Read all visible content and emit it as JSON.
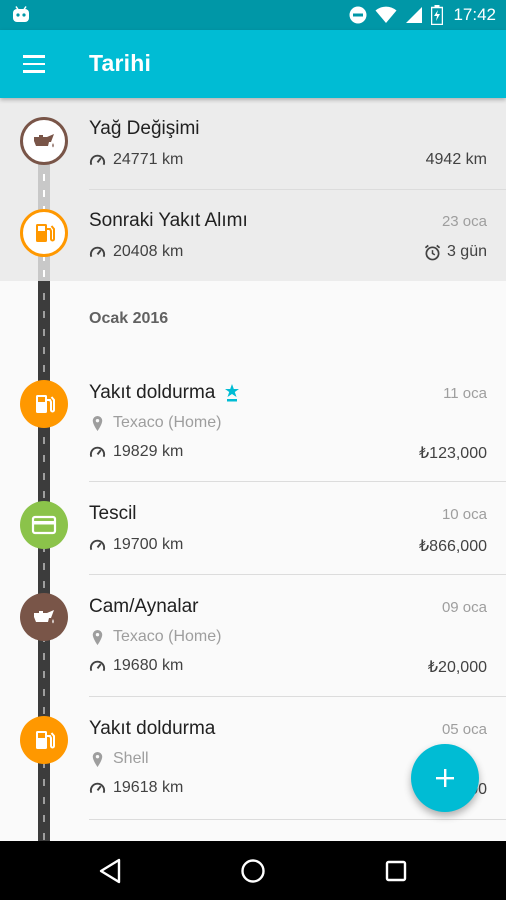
{
  "status_bar": {
    "time": "17:42",
    "icons": [
      "android-icon",
      "do-not-disturb-icon",
      "wifi-icon",
      "signal-icon",
      "battery-charging-icon"
    ]
  },
  "app_bar": {
    "title": "Tarihi",
    "menu_icon": "menu-icon"
  },
  "upcoming": [
    {
      "icon": "oil-can-icon",
      "color": "#795548",
      "title": "Yağ Değişimi",
      "odometer": "24771 km",
      "right_value": "4942 km",
      "date": ""
    },
    {
      "icon": "fuel-pump-icon",
      "color": "#ff9800",
      "title": "Sonraki Yakıt Alımı",
      "odometer": "20408 km",
      "right_value": "3 gün",
      "right_icon": "alarm-icon",
      "date": "23 oca"
    }
  ],
  "section_header": "Ocak 2016",
  "entries": [
    {
      "icon": "fuel-pump-icon",
      "color": "#ff9800",
      "title": "Yakıt doldurma",
      "badge_icon": "full-tank-icon",
      "date": "11 oca",
      "location": "Texaco (Home)",
      "odometer": "19829 km",
      "amount": "₺123,000"
    },
    {
      "icon": "credit-card-icon",
      "color": "#8bc34a",
      "title": "Tescil",
      "date": "10 oca",
      "location": "",
      "odometer": "19700 km",
      "amount": "₺866,000"
    },
    {
      "icon": "oil-can-icon",
      "color": "#795548",
      "title": "Cam/Aynalar",
      "date": "09 oca",
      "location": "Texaco (Home)",
      "odometer": "19680 km",
      "amount": "₺20,000"
    },
    {
      "icon": "fuel-pump-icon",
      "color": "#ff9800",
      "title": "Yakıt doldurma",
      "date": "05 oca",
      "location": "Shell",
      "odometer": "19618 km",
      "amount": "₺…00"
    }
  ],
  "fab": {
    "icon": "plus-icon"
  },
  "nav_bar": {
    "icons": [
      "back-icon",
      "home-icon",
      "recents-icon"
    ]
  },
  "colors": {
    "primary": "#00bcd4",
    "primary_dark": "#0097a7",
    "fuel": "#ff9800",
    "oil": "#795548",
    "registration": "#8bc34a"
  }
}
